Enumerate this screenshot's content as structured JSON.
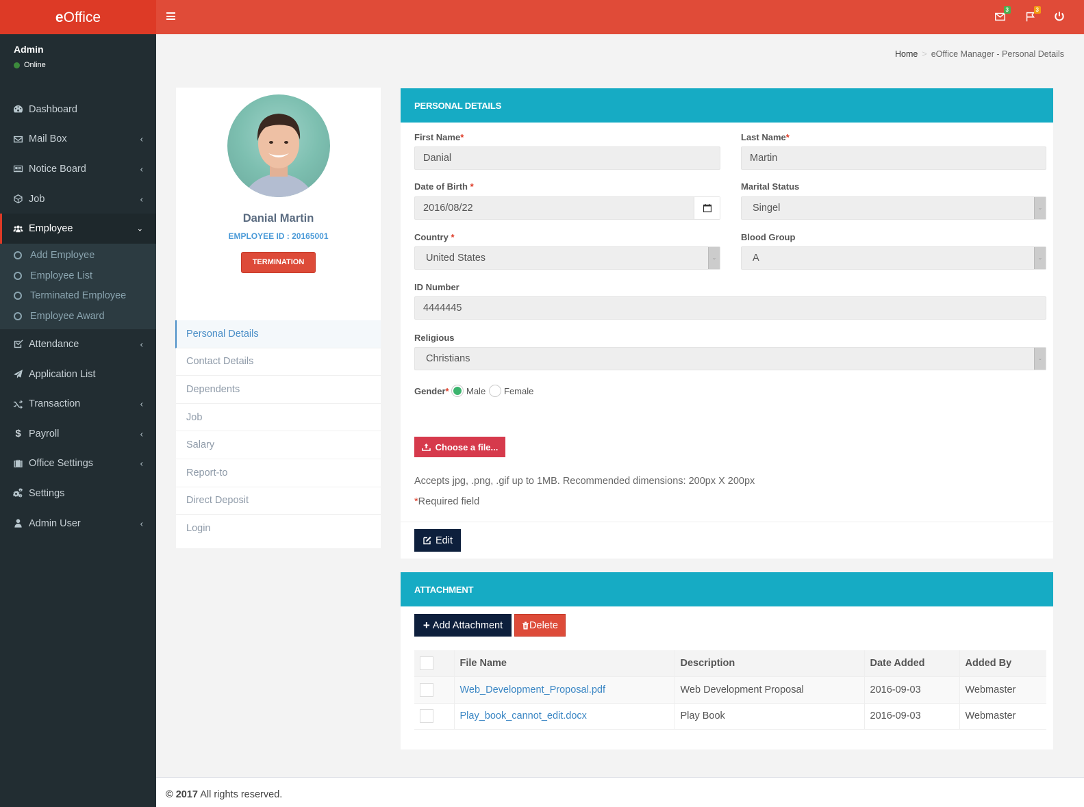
{
  "app": {
    "logo_bold": "e",
    "logo_rest": "Office"
  },
  "user": {
    "name": "Admin",
    "status": "Online",
    "status_color": "#3c8a3c"
  },
  "sidebar": {
    "items": [
      {
        "label": "Dashboard",
        "icon": "dashboard-icon",
        "has_chevron": false
      },
      {
        "label": "Mail Box",
        "icon": "envelope-icon",
        "has_chevron": true
      },
      {
        "label": "Notice Board",
        "icon": "newspaper-icon",
        "has_chevron": true
      },
      {
        "label": "Job",
        "icon": "cube-icon",
        "has_chevron": true
      },
      {
        "label": "Employee",
        "icon": "users-icon",
        "has_chevron": true,
        "active": true
      },
      {
        "label": "Attendance",
        "icon": "check-square-icon",
        "has_chevron": true
      },
      {
        "label": "Application List",
        "icon": "paper-plane-icon",
        "has_chevron": false
      },
      {
        "label": "Transaction",
        "icon": "random-icon",
        "has_chevron": true
      },
      {
        "label": "Payroll",
        "icon": "dollar-icon",
        "has_chevron": true
      },
      {
        "label": "Office Settings",
        "icon": "briefcase-icon",
        "has_chevron": true
      },
      {
        "label": "Settings",
        "icon": "cogs-icon",
        "has_chevron": false
      },
      {
        "label": "Admin User",
        "icon": "user-icon",
        "has_chevron": true
      }
    ],
    "employee_submenu": [
      "Add Employee",
      "Employee List",
      "Terminated Employee",
      "Employee Award"
    ]
  },
  "topbar": {
    "menu_icon": "hamburger-icon",
    "mail_badge": "3",
    "mail_badge_color": "#4caf50",
    "flag_badge": "3",
    "flag_badge_color": "#f39c12"
  },
  "breadcrumb": {
    "home": "Home",
    "separator": ">",
    "current": "eOffice Manager - Personal Details"
  },
  "profile": {
    "name": "Danial Martin",
    "employee_id": "EMPLOYEE ID : 20165001",
    "termination_label": "TERMINATION",
    "nav": [
      "Personal Details",
      "Contact Details",
      "Dependents",
      "Job",
      "Salary",
      "Report-to",
      "Direct Deposit",
      "Login"
    ],
    "active_nav": "Personal Details"
  },
  "personal_details": {
    "title": "PERSONAL DETAILS",
    "first_name": {
      "label": "First Name",
      "required": "*",
      "value": "Danial"
    },
    "last_name": {
      "label": "Last Name",
      "required": "*",
      "value": "Martin"
    },
    "dob": {
      "label": "Date of Birth ",
      "required": "*",
      "value": "2016/08/22"
    },
    "marital": {
      "label": "Marital Status",
      "value": "Singel"
    },
    "country": {
      "label": "Country ",
      "required": "*",
      "value": "United States"
    },
    "blood": {
      "label": "Blood Group",
      "value": "A"
    },
    "id_number": {
      "label": "ID Number",
      "value": "4444445"
    },
    "religious": {
      "label": "Religious",
      "value": "Christians"
    },
    "gender": {
      "label": "Gender",
      "required": "*",
      "options": [
        "Male",
        "Female"
      ],
      "selected": "Male"
    },
    "choose_file": "Choose a file...",
    "accepts_note": "Accepts jpg, .png, .gif up to 1MB. Recommended dimensions: 200px X 200px",
    "required_star": "*",
    "required_note": "Required field",
    "edit_label": "Edit"
  },
  "attachment": {
    "title": "ATTACHMENT",
    "add_label": "Add Attachment",
    "delete_label": "Delete",
    "columns": [
      "File Name",
      "Description",
      "Date Added",
      "Added By"
    ],
    "rows": [
      {
        "file": "Web_Development_Proposal.pdf",
        "description": "Web Development Proposal",
        "date": "2016-09-03",
        "added_by": "Webmaster"
      },
      {
        "file": "Play_book_cannot_edit.docx",
        "description": "Play Book",
        "date": "2016-09-03",
        "added_by": "Webmaster"
      }
    ]
  },
  "footer": {
    "copyright": "© 2017",
    "text": " All rights reserved."
  }
}
